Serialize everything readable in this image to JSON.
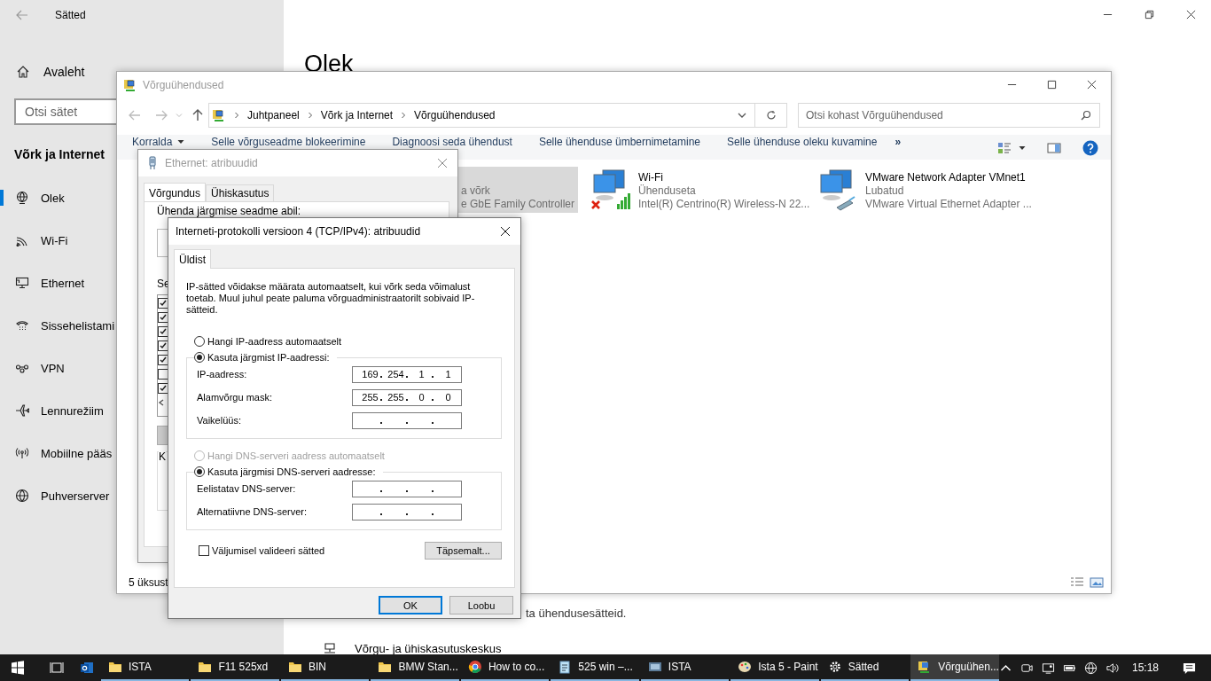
{
  "settings": {
    "title": "Sätted",
    "home": "Avaleht",
    "search_placeholder": "Otsi sätet",
    "section": "Võrk ja Internet",
    "nav": [
      {
        "label": "Olek",
        "kind": "status",
        "selected": true
      },
      {
        "label": "Wi-Fi",
        "kind": "wifi",
        "selected": false
      },
      {
        "label": "Ethernet",
        "kind": "ethernet",
        "selected": false
      },
      {
        "label": "Sissehelistami",
        "kind": "dialup",
        "selected": false
      },
      {
        "label": "VPN",
        "kind": "vpn",
        "selected": false
      },
      {
        "label": "Lennurežiim",
        "kind": "airplane",
        "selected": false
      },
      {
        "label": "Mobiilne pääs",
        "kind": "hotspot",
        "selected": false
      },
      {
        "label": "Puhverserver",
        "kind": "proxy",
        "selected": false
      }
    ],
    "heading": "Olek",
    "change_text": "ta ühendusesätteid.",
    "center_link": "Võrgu- ja ühiskasutuskeskus"
  },
  "network": {
    "title": "Võrguühendused",
    "breadcrumbs": [
      "Juhtpaneel",
      "Võrk ja Internet",
      "Võrguühendused"
    ],
    "search_placeholder": "Otsi kohast Võrguühendused",
    "commands": [
      {
        "label": "Korralda",
        "dropdown": true
      },
      {
        "label": "Selle võrguseadme blokeerimine",
        "dropdown": false
      },
      {
        "label": "Diagnoosi seda ühendust",
        "dropdown": false
      },
      {
        "label": "Selle ühenduse ümbernimetamine",
        "dropdown": false
      },
      {
        "label": "Selle ühenduse oleku kuvamine",
        "dropdown": false
      }
    ],
    "more": "»",
    "items": [
      {
        "kind": "ethernet",
        "selected": true,
        "status": "a võrk",
        "adapter": "e GbE Family Controller"
      },
      {
        "kind": "wifi",
        "selected": false,
        "name": "Wi-Fi",
        "status": "Ühenduseta",
        "adapter": "Intel(R) Centrino(R) Wireless-N 22..."
      },
      {
        "kind": "virtual",
        "selected": false,
        "name": "VMware Network Adapter VMnet1",
        "status": "Lubatud",
        "adapter": "VMware Virtual Ethernet Adapter ..."
      }
    ],
    "status": "5 üksust"
  },
  "ethernet": {
    "title": "Ethernet: atribuudid",
    "tabs": [
      {
        "label": "Võrgundus",
        "selected": true
      },
      {
        "label": "Ühiskasutus",
        "selected": false
      }
    ],
    "connect_label": "Ühenda järgmise seadme abil:",
    "list_label": "Se",
    "checkboxes": [
      {
        "checked": true
      },
      {
        "checked": true
      },
      {
        "checked": true
      },
      {
        "checked": true
      },
      {
        "checked": true
      },
      {
        "checked": false
      },
      {
        "checked": true
      }
    ],
    "group_label": "K"
  },
  "tcp": {
    "title": "Interneti-protokolli versioon 4 (TCP/IPv4): atribuudid",
    "tabs": [
      {
        "label": "Üldist",
        "selected": true
      }
    ],
    "intro": "IP-sätted võidakse määrata automaatselt, kui võrk seda võimalust toetab. Muul juhul peate paluma võrguadministraatorilt sobivaid IP-sätteid.",
    "ip_auto": {
      "label": "Hangi IP-aadress automaatselt",
      "selected": false,
      "disabled": false
    },
    "ip_manual": {
      "label": "Kasuta järgmist IP-aadressi:",
      "selected": true,
      "disabled": false
    },
    "ip_fields": [
      {
        "label": "IP-aadress:",
        "octets": [
          "169",
          "254",
          "1",
          "1"
        ]
      },
      {
        "label": "Alamvõrgu mask:",
        "octets": [
          "255",
          "255",
          "0",
          "0"
        ]
      },
      {
        "label": "Vaikelüüs:"
      }
    ],
    "dns_auto": {
      "label": "Hangi DNS-serveri aadress automaatselt",
      "selected": false,
      "disabled": true
    },
    "dns_manual": {
      "label": "Kasuta järgmisi DNS-serveri aadresse:",
      "selected": true,
      "disabled": false
    },
    "dns_fields": [
      {
        "label": "Eelistatav DNS-server:"
      },
      {
        "label": "Alternatiivne DNS-server:"
      }
    ],
    "validate": {
      "label": "Väljumisel valideeri sätted",
      "checked": false
    },
    "advanced": "Täpsemalt...",
    "ok": "OK",
    "cancel": "Loobu"
  },
  "taskbar": {
    "apps": [
      {
        "label": "ISTA",
        "kind": "folder",
        "active": false
      },
      {
        "label": "F11 525xd",
        "kind": "folder",
        "active": false
      },
      {
        "label": "BIN",
        "kind": "folder",
        "active": false
      },
      {
        "label": "BMW Stan...",
        "kind": "folder",
        "active": false
      },
      {
        "label": "How to co...",
        "kind": "browser",
        "active": false
      },
      {
        "label": "525 win –...",
        "kind": "notepad",
        "active": false
      },
      {
        "label": "ISTA",
        "kind": "app",
        "active": false
      },
      {
        "label": "Ista 5 - Paint",
        "kind": "paint",
        "active": false
      },
      {
        "label": "Sätted",
        "kind": "gear",
        "active": false
      },
      {
        "label": "Võrguühen...",
        "kind": "network",
        "active": true
      }
    ],
    "time": "15:18"
  }
}
